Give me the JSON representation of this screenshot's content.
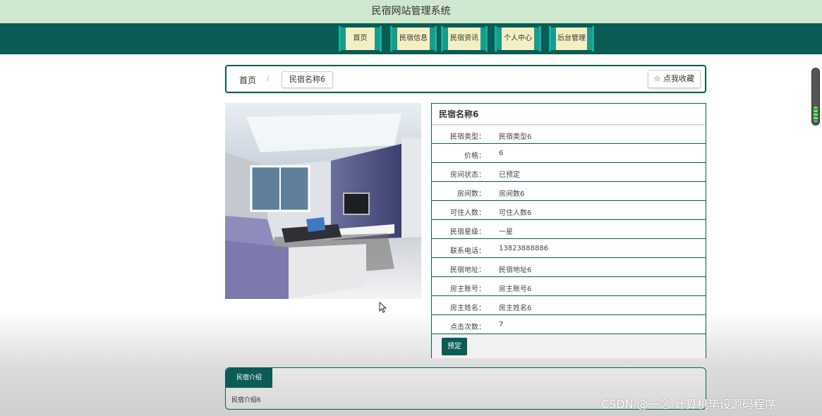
{
  "header": {
    "title": "民宿网站管理系统"
  },
  "nav": {
    "items": [
      {
        "label": "首页"
      },
      {
        "label": "民宿信息"
      },
      {
        "label": "民宿资讯"
      },
      {
        "label": "个人中心"
      },
      {
        "label": "后台管理"
      }
    ]
  },
  "breadcrumb": {
    "home": "首页",
    "separator": "/",
    "current": "民宿名称6"
  },
  "favorite_button": {
    "icon": "star-outline-icon",
    "label": "☆ 点我收藏"
  },
  "details": {
    "title": "民宿名称6",
    "rows": [
      {
        "label": "民宿类型：",
        "value": "民宿类型6"
      },
      {
        "label": "价格：",
        "value": "6"
      },
      {
        "label": "房间状态：",
        "value": "已预定"
      },
      {
        "label": "房间数：",
        "value": "房间数6"
      },
      {
        "label": "可住人数：",
        "value": "可住人数6"
      },
      {
        "label": "民宿星级：",
        "value": "一星"
      },
      {
        "label": "联系电话：",
        "value": "13823888886"
      },
      {
        "label": "民宿地址：",
        "value": "民宿地址6"
      },
      {
        "label": "房主账号：",
        "value": "房主账号6"
      },
      {
        "label": "房主姓名：",
        "value": "房主姓名6"
      },
      {
        "label": "点击次数：",
        "value": "7"
      }
    ],
    "book_button": "预定"
  },
  "intro": {
    "tab_label": "民宿介绍",
    "text": "民宿介绍6"
  },
  "watermark": "CSDN @一念 计算机毕设源码程序",
  "colors": {
    "primary": "#0a5c55",
    "title_bar": "#cfe6cf",
    "nav_button": "#f4efc2",
    "nav_button_edge": "#1a9b8c"
  }
}
